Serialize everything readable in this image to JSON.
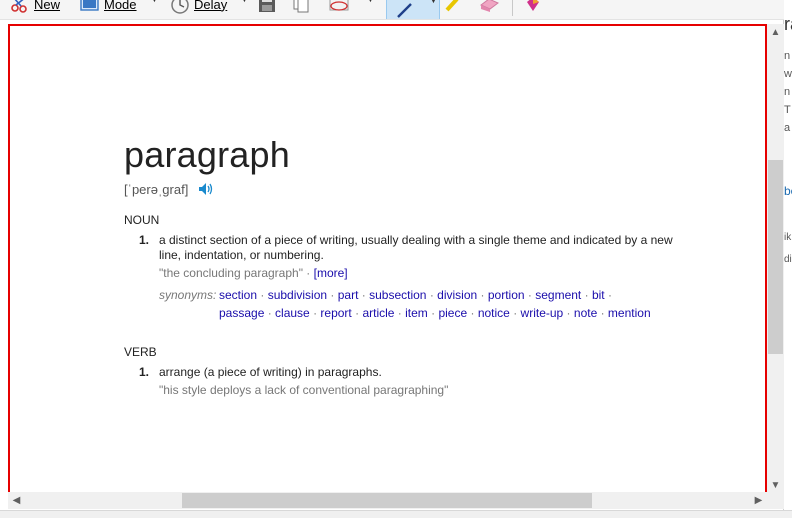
{
  "toolbar": {
    "new_label": "New",
    "mode_label": "Mode",
    "delay_label": "Delay"
  },
  "behind_window": {
    "chars": [
      "ra",
      "n",
      "w",
      "n",
      "T",
      "a",
      "be",
      "ik",
      "di"
    ]
  },
  "dictionary": {
    "headword": "paragraph",
    "pronunciation": "[ˈperəˌɡraf]",
    "noun": {
      "pos": "NOUN",
      "sense_number": "1.",
      "definition": "a distinct section of a piece of writing, usually dealing with a single theme and indicated by a new line, indentation, or numbering.",
      "example": "\"the concluding paragraph\" · ",
      "more": "[more]",
      "synonyms_label": "synonyms:",
      "synonyms": [
        "section",
        "subdivision",
        "part",
        "subsection",
        "division",
        "portion",
        "segment",
        "bit",
        "passage",
        "clause",
        "report",
        "article",
        "item",
        "piece",
        "notice",
        "write-up",
        "note",
        "mention"
      ]
    },
    "verb": {
      "pos": "VERB",
      "sense_number": "1.",
      "definition": "arrange (a piece of writing) in paragraphs.",
      "example": "\"his style deploys a lack of conventional paragraphing\""
    }
  }
}
